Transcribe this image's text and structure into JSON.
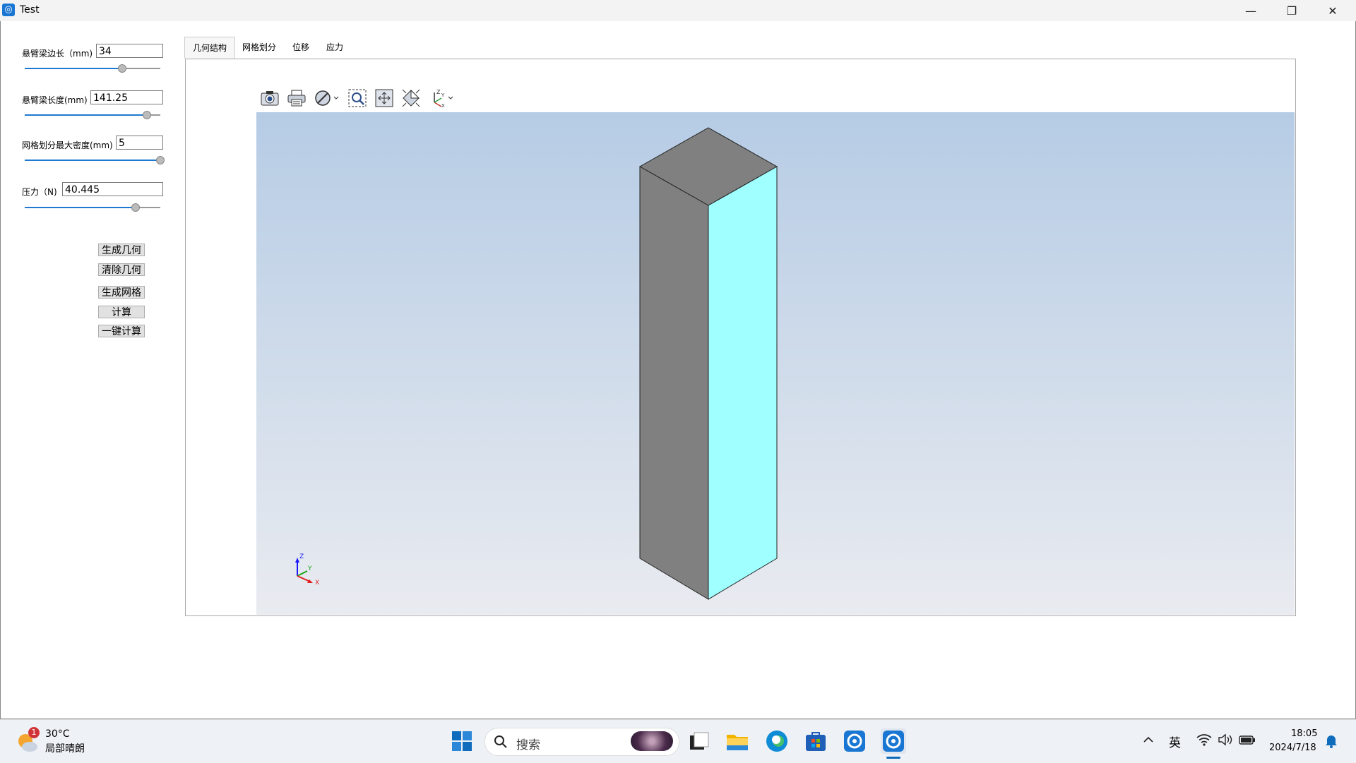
{
  "window": {
    "title": "Test",
    "minimize": "—",
    "maximize": "❐",
    "close": "✕"
  },
  "params": [
    {
      "label": "悬臂梁边长（mm)",
      "value": "34",
      "slider_fraction": 0.72
    },
    {
      "label": "悬臂梁长度(mm)",
      "value": "141.25",
      "slider_fraction": 0.9
    },
    {
      "label": "网格划分最大密度(mm)",
      "value": "5",
      "slider_fraction": 1.0
    },
    {
      "label": "压力（N)",
      "value": "40.445",
      "slider_fraction": 0.82
    }
  ],
  "buttons": {
    "gen_geometry": "生成几何",
    "clear_geometry": "清除几何",
    "gen_mesh": "生成网格",
    "compute": "计算",
    "one_click": "一键计算"
  },
  "tabs": [
    "几何结构",
    "网格划分",
    "位移",
    "应力"
  ],
  "active_tab": "几何结构",
  "toolbar": [
    "camera-icon",
    "print-icon",
    "clip-plane-icon",
    "zoom-window-icon",
    "fit-all-icon",
    "view-iso-icon",
    "axes-triad-icon"
  ],
  "viewport": {
    "triad": {
      "x": "X",
      "y": "Y",
      "z": "Z"
    },
    "colors": {
      "top_face": "#808080",
      "left_face": "#808080",
      "right_face": "#a0ffff",
      "bg_top": "#b6cce5",
      "bg_bottom": "#e9ebf0"
    }
  },
  "taskbar": {
    "weather_temp": "30°C",
    "weather_desc": "局部晴朗",
    "weather_badge": "1",
    "search_placeholder": "搜索",
    "ime": "英",
    "time": "18:05",
    "date": "2024/7/18"
  }
}
